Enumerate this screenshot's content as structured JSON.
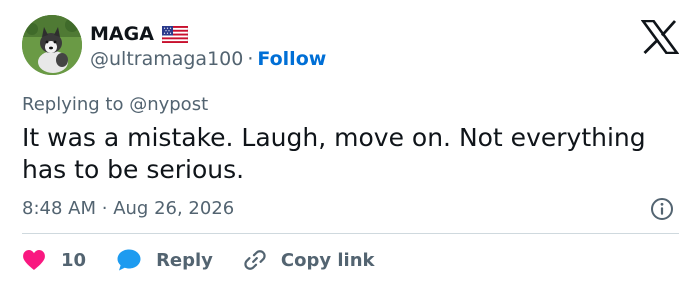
{
  "author": {
    "display_name": "MAGA",
    "handle": "@ultramaga100",
    "separator": "·",
    "follow_label": "Follow",
    "badge_icon": "us-flag-icon"
  },
  "reply_context": "Replying to @nypost",
  "tweet": {
    "text": "It was a mistake. Laugh, move on. Not everything has to be serious.",
    "time": "8:48 AM",
    "separator": "·",
    "date": "Aug 26, 2026"
  },
  "actions": {
    "like_count": "10",
    "reply_label": "Reply",
    "copy_link_label": "Copy link"
  },
  "colors": {
    "like": "#f91880",
    "reply": "#1d9bf0",
    "link": "#006fd6",
    "muted": "#536471",
    "text": "#0f1419"
  }
}
